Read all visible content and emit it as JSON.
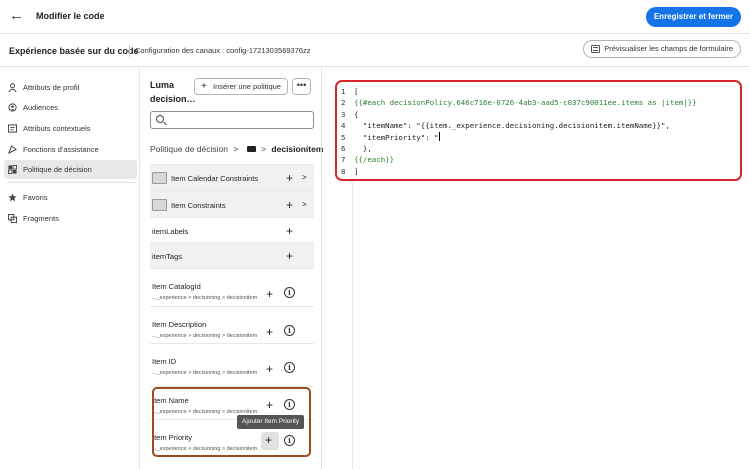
{
  "topbar": {
    "title": "Modifier le code",
    "save_label": "Enregistrer et fermer"
  },
  "subbar": {
    "experience_title": "Expérience basée sur du code",
    "config_text": "Configuration des canaux : config-1721303569376zz",
    "preview_label": "Prévisualiser les champs de formulaire"
  },
  "left_nav": {
    "items": [
      {
        "label": "Attributs de profil",
        "icon": "person-icon"
      },
      {
        "label": "Audiences",
        "icon": "audience-icon"
      },
      {
        "label": "Attributs contextuels",
        "icon": "context-icon"
      },
      {
        "label": "Fonctions d'assistance",
        "icon": "function-icon"
      },
      {
        "label": "Politique de décision",
        "icon": "decision-icon",
        "active": true
      }
    ],
    "secondary": [
      {
        "label": "Favoris",
        "icon": "star-icon"
      },
      {
        "label": "Fragments",
        "icon": "fragment-icon"
      }
    ]
  },
  "middle": {
    "title": "Luma decision…",
    "insert_label": "Insérer une politique",
    "more_label": "•••",
    "breadcrumb_root": "Politique de décision",
    "breadcrumb_sep": ">",
    "breadcrumb_current": "decisionitem",
    "rows": [
      {
        "label": "Item Calendar Constraints",
        "type": "folder"
      },
      {
        "label": "Item Constraints",
        "type": "folder"
      },
      {
        "label": "itemLabels",
        "type": "plain"
      },
      {
        "label": "itemTags",
        "type": "plain"
      },
      {
        "label": "Item CatalogId",
        "path": "..._experience > decisioning > decisionitem",
        "type": "field"
      },
      {
        "label": "Item Description",
        "path": "..._experience > decisioning > decisionitem",
        "type": "field"
      },
      {
        "label": "Item ID",
        "path": "..._experience > decisioning > decisionitem",
        "type": "field"
      },
      {
        "label": "Item Name",
        "path": "..._experience > decisioning > decisionitem",
        "type": "field"
      },
      {
        "label": "Item Priority",
        "path": "..._experience > decisioning > decisionitem",
        "type": "field"
      }
    ],
    "tooltip": "Ajouter Item Priority"
  },
  "editor": {
    "lines": [
      {
        "n": "1",
        "text": "["
      },
      {
        "n": "2",
        "text": "{{#each decisionPolicy.646c716e-0726-4ab3-aad5-c037c90011ee.items as |item|}}"
      },
      {
        "n": "3",
        "text": "{"
      },
      {
        "n": "4",
        "text": "  \"itemName\": \"{{item._experience.decisioning.decisionitem.itemName}}\","
      },
      {
        "n": "5",
        "text": "  \"itemPriority\": \""
      },
      {
        "n": "6",
        "text": "  },"
      },
      {
        "n": "7",
        "text": "{{/each}}"
      },
      {
        "n": "8",
        "text": "]"
      }
    ]
  },
  "colors": {
    "accent": "#1473e6",
    "highlight_border": "#d7262e",
    "selection_border": "#9a4d22"
  }
}
